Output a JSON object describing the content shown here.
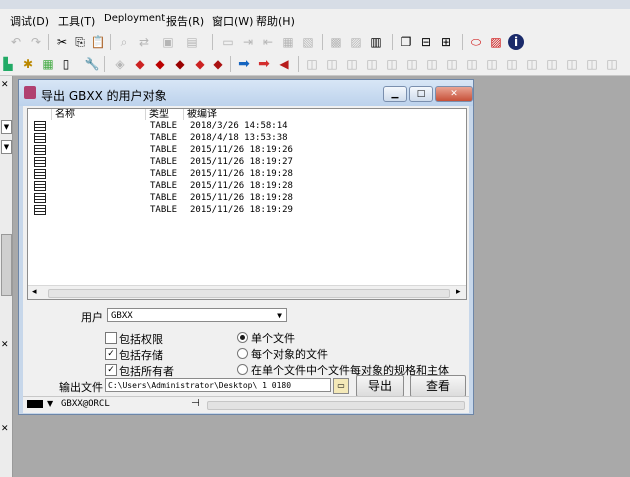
{
  "menu": [
    "调试(D)",
    "工具(T)",
    "Deployment",
    "报告(R)",
    "窗口(W)",
    "帮助(H)"
  ],
  "dialog": {
    "title": "导出 GBXX 的用户对象",
    "columns": [
      "名称",
      "类型",
      "被编译"
    ],
    "rows": [
      {
        "name": "",
        "type": "TABLE",
        "compiled": "2018/3/26 14:58:14"
      },
      {
        "name": "",
        "type": "TABLE",
        "compiled": "2018/4/18 13:53:38"
      },
      {
        "name": "",
        "type": "TABLE",
        "compiled": "2015/11/26 18:19:26"
      },
      {
        "name": "",
        "type": "TABLE",
        "compiled": "2015/11/26 18:19:27"
      },
      {
        "name": "",
        "type": "TABLE",
        "compiled": "2015/11/26 18:19:28"
      },
      {
        "name": "",
        "type": "TABLE",
        "compiled": "2015/11/26 18:19:28"
      },
      {
        "name": "",
        "type": "TABLE",
        "compiled": "2015/11/26 18:19:28"
      },
      {
        "name": "",
        "type": "TABLE",
        "compiled": "2015/11/26 18:19:29"
      }
    ],
    "user_label": "用户",
    "user_value": "GBXX",
    "checkboxes": [
      {
        "label": "包括权限",
        "checked": false
      },
      {
        "label": "包括存储",
        "checked": true
      },
      {
        "label": "包括所有者",
        "checked": true
      }
    ],
    "radios": [
      {
        "label": "单个文件",
        "selected": true
      },
      {
        "label": "每个对象的文件",
        "selected": false
      },
      {
        "label": "在单个文件中个文件每对象的规格和主体",
        "selected": false
      }
    ],
    "output_label": "输出文件",
    "output_value": "C:\\Users\\Administrator\\Desktop\\   1    0180",
    "export_button": "导出",
    "view_button": "查看",
    "connection": "GBXX@ORCL"
  },
  "colors": {
    "title_bg": "#c7d7ea",
    "close_btn": "#c75038",
    "workspace": "#a9a9a9"
  }
}
